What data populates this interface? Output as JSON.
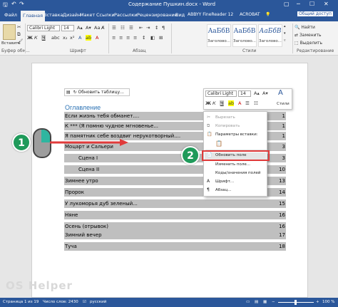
{
  "window": {
    "title": "Содержание Пушкин.docx - Word",
    "controls": [
      "▢",
      "─",
      "☐",
      "✕"
    ]
  },
  "tabs": [
    {
      "label": "Файл"
    },
    {
      "label": "Главная"
    },
    {
      "label": "Вставка"
    },
    {
      "label": "Дизайн"
    },
    {
      "label": "Макет"
    },
    {
      "label": "Ссылки"
    },
    {
      "label": "Рассылки"
    },
    {
      "label": "Рецензирование"
    },
    {
      "label": "Вид"
    },
    {
      "label": "ABBYY FineReader 12"
    },
    {
      "label": "ACROBAT"
    }
  ],
  "tell_me": "Что вы хотите сделать?",
  "share": "Общий доступ",
  "ribbon": {
    "paste": "Вставить",
    "clipboard": "Буфер обм...",
    "font_name": "Calibri Light",
    "font_size": "14",
    "bold": "Ж",
    "italic": "К",
    "underline": "Ч",
    "font_group": "Шрифт",
    "paragraph_group": "Абзац",
    "styles_group": "Стили",
    "styles_btn": "Стили",
    "editing_group": "Редактирование",
    "find": "Найти",
    "replace": "Заменить",
    "select": "Выделить",
    "styles": [
      {
        "sample": "АаБбВ",
        "name": "Заголово..."
      },
      {
        "sample": "АаБбВ",
        "name": "Заголово..."
      },
      {
        "sample": "АаБбВ",
        "name": "Заголово..."
      }
    ]
  },
  "toc": {
    "toolbar_label": "Обновить таблицу...",
    "heading": "Оглавление",
    "rows": [
      {
        "text": "Если жизнь тебя обманет....",
        "page": "1"
      },
      {
        "text": "К *** (Я помню чудное мгновенье...",
        "page": "1"
      },
      {
        "text": "Я памятник себе воздвиг нерукотворный....",
        "page": "1"
      },
      {
        "text": "Моцарт и Сальери",
        "page": "3"
      },
      {
        "text": "Сцена I",
        "page": "3"
      },
      {
        "text": "Сцена II",
        "page": "10"
      },
      {
        "text": "Зимнее утро",
        "page": "13"
      },
      {
        "text": "Пророк",
        "page": "14"
      },
      {
        "text": "У лукоморья дуб зеленый...",
        "page": "15"
      },
      {
        "text": "Няне",
        "page": "16"
      },
      {
        "text": "Осень (отрывок)",
        "page": "16"
      },
      {
        "text": "Зимний вечер",
        "page": "17"
      },
      {
        "text": "Туча",
        "page": "18"
      }
    ]
  },
  "mini_toolbar": {
    "font": "Calibri Light",
    "size": "14",
    "bold": "Ж",
    "italic": "К",
    "underline": "Ч",
    "styles": "Стили"
  },
  "context_menu": {
    "items": [
      {
        "label": "Вырезать",
        "disabled": true
      },
      {
        "label": "Копировать",
        "disabled": true
      },
      {
        "label": "Параметры вставки:",
        "disabled": false
      },
      {
        "label": "Обновить поле",
        "disabled": false
      },
      {
        "label": "Изменить поле...",
        "disabled": false
      },
      {
        "label": "Коды/значения полей",
        "disabled": false
      },
      {
        "label": "Шрифт...",
        "disabled": false
      },
      {
        "label": "Абзац...",
        "disabled": false
      }
    ]
  },
  "badges": {
    "one": "1",
    "two": "2"
  },
  "status": {
    "page": "Страница 1 из 19",
    "words": "Число слов: 2430",
    "language": "русский",
    "zoom": "100 %"
  },
  "watermark": "OS Helper",
  "colors": {
    "brand": "#2b579a",
    "badge": "#1f9a5a",
    "highlight": "#e03a3a",
    "toc_shade": "#bfbfbf"
  }
}
